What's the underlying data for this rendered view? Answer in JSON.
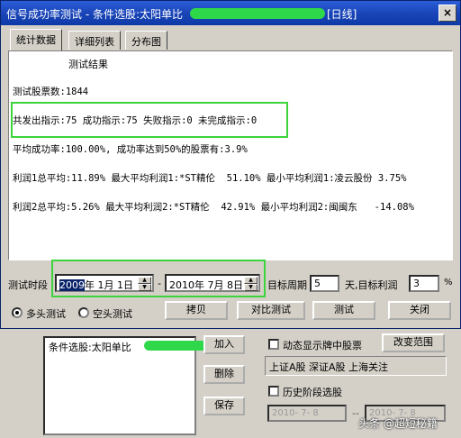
{
  "window": {
    "title": "信号成功率测试 - 条件选股:太阳单比",
    "title_suffix": "[日线]",
    "close_label": "×"
  },
  "tabs": [
    {
      "label": "统计数据",
      "active": true
    },
    {
      "label": "详细列表",
      "active": false
    },
    {
      "label": "分布图",
      "active": false
    }
  ],
  "results": {
    "heading": "测试结果",
    "total_stocks": "测试股票数:1844",
    "signals": "共发出指示:75 成功指示:75 失败指示:0 未完成指示:0",
    "success_rate": "平均成功率:100.00%, 成功率达到50%的股票有:3.9%",
    "profit1": "利润1总平均:11.89% 最大平均利润1:*ST精伦  51.10% 最小平均利润1:凌云股份 3.75%",
    "profit2": "利润2总平均:5.26% 最大平均利润2:*ST精伦  42.91% 最小平均利润2:闽闽东   -14.08%"
  },
  "controls": {
    "period_label": "测试时段",
    "start_date_year": "2009",
    "start_date_rest": "年  1月  1日",
    "dash": "-",
    "end_date": "2010年  7月  8日",
    "target_period_label": "目标周期",
    "target_period_value": "5",
    "target_profit_label": "天,目标利润",
    "target_profit_value": "3",
    "percent": "%",
    "radio_long": "多头测试",
    "radio_short": "空头测试",
    "copy_button": "拷贝",
    "compare_button": "对比测试",
    "test_button": "测试",
    "close_button": "关闭"
  },
  "background": {
    "list_item": "条件选股:太阳单比",
    "add_button": "加入",
    "delete_button": "删除",
    "save_button": "保存",
    "dynamic_label": "动态显示牌中股票",
    "change_range_button": "改变范围",
    "range_text": "上证A股 深证A股 上海关注",
    "history_label": "历史阶段选股",
    "hist_start": "2010- 7- 8",
    "hist_sep": "--",
    "hist_end": "2010- 7- 8",
    "watermark": "头条 @超短秘籍"
  },
  "colors": {
    "titlebar": "#1a45b8",
    "highlight": "#3cd33c",
    "scribble": "#2fd84a"
  }
}
